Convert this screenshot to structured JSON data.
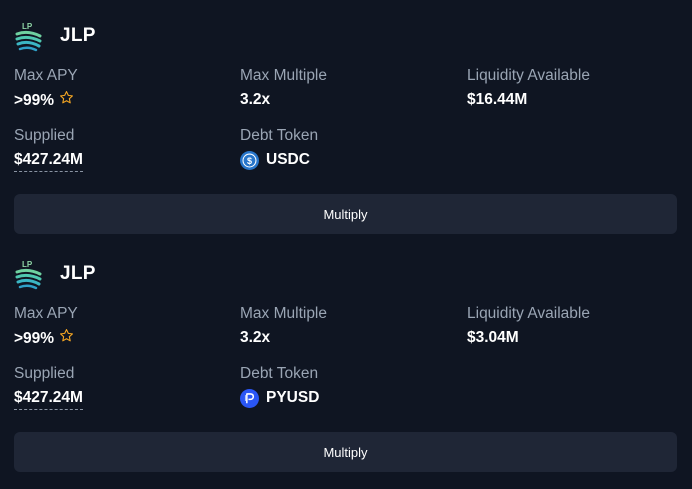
{
  "cards": [
    {
      "token": "JLP",
      "logo_text": "LP",
      "max_apy_label": "Max APY",
      "max_apy_value": ">99%",
      "max_multiple_label": "Max Multiple",
      "max_multiple_value": "3.2x",
      "liquidity_label": "Liquidity Available",
      "liquidity_value": "$16.44M",
      "supplied_label": "Supplied",
      "supplied_value": "$427.24M",
      "debt_token_label": "Debt Token",
      "debt_token_value": "USDC",
      "debt_token_icon": "usdc-coin-icon",
      "button_label": "Multiply"
    },
    {
      "token": "JLP",
      "logo_text": "LP",
      "max_apy_label": "Max APY",
      "max_apy_value": ">99%",
      "max_multiple_label": "Max Multiple",
      "max_multiple_value": "3.2x",
      "liquidity_label": "Liquidity Available",
      "liquidity_value": "$3.04M",
      "supplied_label": "Supplied",
      "supplied_value": "$427.24M",
      "debt_token_label": "Debt Token",
      "debt_token_value": "PYUSD",
      "debt_token_icon": "pyusd-coin-icon",
      "button_label": "Multiply"
    }
  ],
  "colors": {
    "background": "#0f1522",
    "label": "#9aa5b4",
    "button": "#1f2636",
    "star": "#f5a623",
    "usdc": "#2775ca",
    "pyusd": "#2a56f5"
  }
}
